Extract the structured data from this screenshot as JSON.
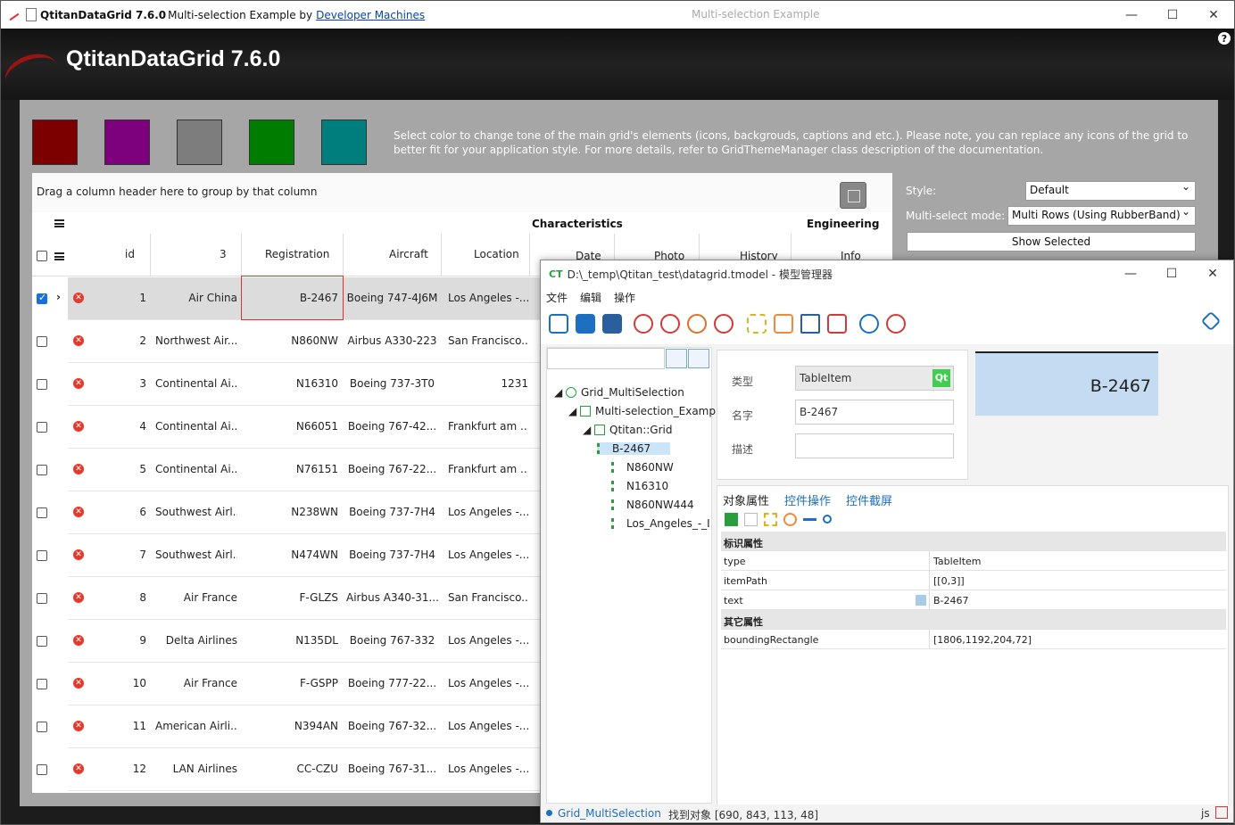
{
  "window": {
    "title_bold": "QtitanDataGrid 7.6.0",
    "title_rest": "Multi-selection Example by",
    "title_link": "Developer Machines",
    "center_title": "Multi-selection Example"
  },
  "banner": {
    "title": "QtitanDataGrid 7.6.0",
    "help": "?"
  },
  "swatches": [
    "#7d0000",
    "#7d007d",
    "#7d7d7d",
    "#007d00",
    "#007d7d"
  ],
  "description": "Select color to change tone of the main grid's elements (icons, backgrouds, captions and etc.). Please note, you can replace any icons of the grid to better fit for your application style. For more details, refer to GridThemeManager class description of the documentation.",
  "grid": {
    "group_hint": "Drag a column header here to group by that column",
    "bands": {
      "characteristics": "Characteristics",
      "engineering": "Engineering"
    },
    "columns": {
      "id": "id",
      "c3": "3",
      "registration": "Registration",
      "aircraft": "Aircraft",
      "location": "Location",
      "date": "Date",
      "photo": "Photo",
      "history": "History",
      "info": "Info"
    },
    "rows": [
      {
        "id": "1",
        "airline": "Air China",
        "reg": "B-2467",
        "aircraft": "Boeing 747-4J6M",
        "loc": "Los Angeles -..."
      },
      {
        "id": "2",
        "airline": "Northwest Air...",
        "reg": "N860NW",
        "aircraft": "Airbus A330-223",
        "loc": "San Francisco..."
      },
      {
        "id": "3",
        "airline": "Continental Ai...",
        "reg": "N16310",
        "aircraft": "Boeing 737-3T0",
        "loc": "1231"
      },
      {
        "id": "4",
        "airline": "Continental Ai...",
        "reg": "N66051",
        "aircraft": "Boeing 767-42...",
        "loc": "Frankfurt am ..."
      },
      {
        "id": "5",
        "airline": "Continental Ai...",
        "reg": "N76151",
        "aircraft": "Boeing 767-22...",
        "loc": "Frankfurt am ..."
      },
      {
        "id": "6",
        "airline": "Southwest Airl...",
        "reg": "N238WN",
        "aircraft": "Boeing 737-7H4",
        "loc": "Los Angeles -..."
      },
      {
        "id": "7",
        "airline": "Southwest Airl...",
        "reg": "N474WN",
        "aircraft": "Boeing 737-7H4",
        "loc": "Los Angeles -..."
      },
      {
        "id": "8",
        "airline": "Air France",
        "reg": "F-GLZS",
        "aircraft": "Airbus A340-31...",
        "loc": "San Francisco..."
      },
      {
        "id": "9",
        "airline": "Delta Airlines",
        "reg": "N135DL",
        "aircraft": "Boeing 767-332",
        "loc": "Los Angeles -..."
      },
      {
        "id": "10",
        "airline": "Air France",
        "reg": "F-GSPP",
        "aircraft": "Boeing 777-22...",
        "loc": "Los Angeles -..."
      },
      {
        "id": "11",
        "airline": "American Airli...",
        "reg": "N394AN",
        "aircraft": "Boeing 767-32...",
        "loc": "Los Angeles -..."
      },
      {
        "id": "12",
        "airline": "LAN Airlines",
        "reg": "CC-CZU",
        "aircraft": "Boeing 767-31...",
        "loc": "Los Angeles -..."
      }
    ]
  },
  "settings": {
    "style_label": "Style:",
    "style_value": "Default",
    "multiselect_label": "Multi-select mode:",
    "multiselect_value": "Multi Rows (Using RubberBand)",
    "show_selected": "Show Selected"
  },
  "model_manager": {
    "title": "D:\\_temp\\Qtitan_test\\datagrid.tmodel - 模型管理器",
    "logo": "CT",
    "menu": [
      "文件",
      "编辑",
      "操作"
    ],
    "tree": [
      {
        "label": "Grid_MultiSelection"
      },
      {
        "label": "Multi-selection_Exampl"
      },
      {
        "label": "Qtitan::Grid"
      },
      {
        "label": "B-2467"
      },
      {
        "label": "N860NW"
      },
      {
        "label": "N16310"
      },
      {
        "label": "N860NW444"
      },
      {
        "label": "Los_Angeles_-_I"
      }
    ],
    "detail": {
      "type_label": "类型",
      "type_value": "TableItem",
      "qt_badge": "Qt",
      "name_label": "名字",
      "name_value": "B-2467",
      "desc_label": "描述",
      "desc_value": ""
    },
    "preview_text": "B-2467",
    "tabs": [
      "对象属性",
      "控件操作",
      "控件截屏"
    ],
    "props": {
      "group1": "标识属性",
      "rows1": [
        {
          "k": "type",
          "v": "TableItem"
        },
        {
          "k": "itemPath",
          "v": "[[0,3]]"
        },
        {
          "k": "text",
          "v": "B-2467"
        }
      ],
      "group2": "其它属性",
      "rows2": [
        {
          "k": "boundingRectangle",
          "v": "[1806,1192,204,72]"
        }
      ]
    },
    "status": {
      "object": "Grid_MultiSelection",
      "found": "找到对象 [690, 843, 113, 48]",
      "js": "js"
    }
  }
}
